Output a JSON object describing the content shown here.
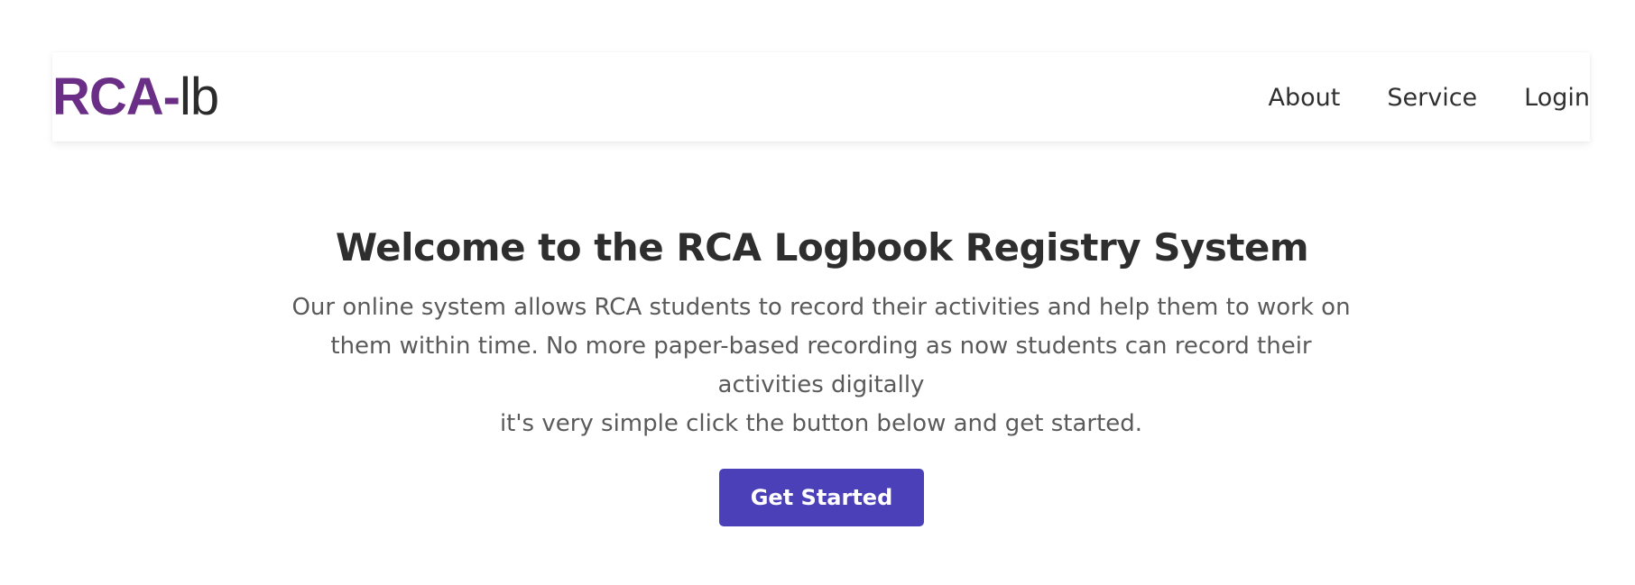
{
  "header": {
    "logo_strong": "RCA-",
    "logo_light": "lb",
    "nav": [
      {
        "label": "About"
      },
      {
        "label": "Service"
      },
      {
        "label": "Login"
      }
    ]
  },
  "hero": {
    "title": "Welcome to the RCA Logbook Registry System",
    "description": "Our online system allows RCA students to record their activities and help them to work on them within time. No more paper-based recording as now students can record their activities digitally",
    "description_line2": "it's very simple click the button below and get started.",
    "cta_label": "Get Started"
  },
  "colors": {
    "brand": "#6a2e86",
    "button": "#4b40b7"
  }
}
